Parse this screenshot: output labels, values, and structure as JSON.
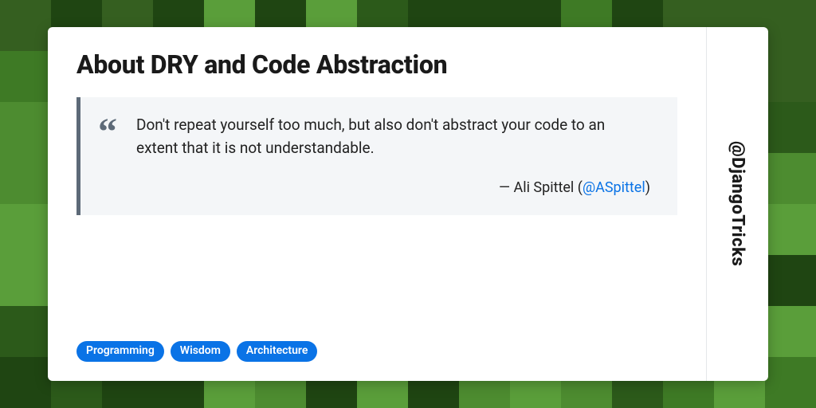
{
  "title": "About DRY and Code Abstraction",
  "quote": "Don't repeat yourself too much, but also don't abstract your code to an extent that it is not understandable.",
  "author_prefix": "— Ali Spittel (",
  "author_handle": "@ASpittel",
  "author_suffix": ")",
  "tags": [
    "Programming",
    "Wisdom",
    "Architecture"
  ],
  "account_handle": "@DjangoTricks",
  "bg_palette": [
    "#2c5a1a",
    "#3e7a25",
    "#4d8c30",
    "#5a9e3a",
    "#1f4512",
    "#355f20"
  ]
}
